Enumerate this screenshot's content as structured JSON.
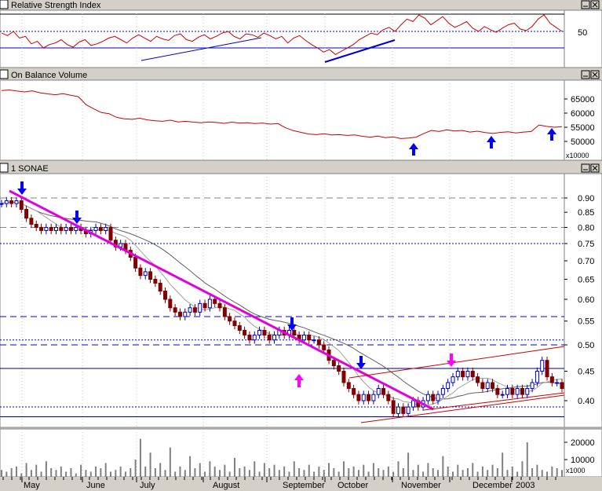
{
  "panes": {
    "rsi": {
      "title": "Relative Strength Index"
    },
    "obv": {
      "title": "On Balance Volume",
      "units": "x10000"
    },
    "price": {
      "title": "1 SONAE"
    },
    "volume": {
      "units": "x1000"
    }
  },
  "colors": {
    "price_line": "#cc0000",
    "trend_magenta": "#e000e0",
    "trend_blue": "#0000cc",
    "channel_red": "#cc0000",
    "arrow_blue": "#0000ff",
    "arrow_magenta": "#ff00ff",
    "candle_down": "#800000",
    "candle_up": "#0000c0",
    "volume_bar": "#808080",
    "ma_gray": "#606060"
  },
  "chart_data": [
    {
      "type": "line",
      "name": "Relative Strength Index",
      "ylim": [
        0,
        100
      ],
      "yticks": [
        50
      ],
      "reference_lines": [
        50,
        30,
        70
      ],
      "months": [
        "May",
        "June",
        "July",
        "August",
        "September",
        "October",
        "November",
        "December",
        "2003"
      ],
      "values": [
        48,
        45,
        50,
        42,
        44,
        35,
        38,
        30,
        34,
        36,
        40,
        34,
        31,
        37,
        40,
        33,
        35,
        38,
        42,
        44,
        40,
        36,
        42,
        46,
        42,
        38,
        44,
        41,
        39,
        45,
        47,
        40,
        38,
        43,
        46,
        41,
        44,
        48,
        50,
        44,
        41,
        47,
        46,
        43,
        48,
        45,
        41,
        44,
        36,
        42,
        45,
        39,
        34,
        30,
        25,
        28,
        22,
        26,
        30,
        34,
        40,
        44,
        48,
        46,
        52,
        55,
        50,
        58,
        65,
        62,
        70,
        66,
        58,
        63,
        68,
        60,
        55,
        58,
        62,
        54,
        50,
        56,
        52,
        49,
        54,
        58,
        60,
        53,
        51,
        56,
        65,
        70,
        60,
        55,
        50
      ]
    },
    {
      "type": "line",
      "name": "On Balance Volume",
      "ylim": [
        45000,
        70000
      ],
      "yticks": [
        50000,
        55000,
        60000,
        65000
      ],
      "units": "x10000",
      "values": [
        68000,
        68200,
        67800,
        67500,
        67900,
        67200,
        66800,
        66500,
        66900,
        66300,
        65800,
        63000,
        61500,
        60200,
        59800,
        58500,
        58000,
        57800,
        58200,
        57600,
        57300,
        57100,
        57500,
        56900,
        57100,
        56800,
        56600,
        56900,
        56700,
        56400,
        56800,
        56500,
        56600,
        56300,
        56500,
        56100,
        56300,
        54800,
        53800,
        53200,
        52600,
        52400,
        52700,
        52300,
        52400,
        52100,
        52300,
        51800,
        51500,
        51900,
        51300,
        51600,
        51000,
        51200,
        51500,
        52800,
        53900,
        53500,
        54100,
        53700,
        53900,
        53300,
        53600,
        53100,
        52800,
        53200,
        53400,
        53000,
        53300,
        53500,
        55800,
        55300,
        55000,
        55200
      ]
    },
    {
      "type": "candlestick",
      "name": "SONAE",
      "ylim": [
        0.36,
        0.96
      ],
      "yscale": "log",
      "yticks": [
        0.4,
        0.45,
        0.5,
        0.55,
        0.6,
        0.65,
        0.7,
        0.75,
        0.8,
        0.85,
        0.9
      ],
      "ytick_labels": [
        "0.40",
        "0.45",
        "0.50",
        "0.55",
        "0.60",
        "0.65",
        "0.70",
        "0.75",
        "0.80",
        "0.85",
        "0.90"
      ],
      "xlabels": [
        "May",
        "June",
        "July",
        "August",
        "September",
        "October",
        "November",
        "December",
        "2003"
      ],
      "close": [
        0.88,
        0.89,
        0.88,
        0.89,
        0.86,
        0.83,
        0.81,
        0.8,
        0.79,
        0.8,
        0.79,
        0.8,
        0.79,
        0.8,
        0.79,
        0.8,
        0.79,
        0.78,
        0.79,
        0.8,
        0.79,
        0.8,
        0.76,
        0.74,
        0.75,
        0.73,
        0.71,
        0.68,
        0.66,
        0.67,
        0.65,
        0.64,
        0.62,
        0.6,
        0.58,
        0.57,
        0.56,
        0.57,
        0.58,
        0.57,
        0.59,
        0.58,
        0.6,
        0.59,
        0.58,
        0.56,
        0.55,
        0.54,
        0.53,
        0.52,
        0.51,
        0.52,
        0.53,
        0.52,
        0.51,
        0.52,
        0.53,
        0.52,
        0.53,
        0.52,
        0.51,
        0.52,
        0.51,
        0.51,
        0.5,
        0.49,
        0.47,
        0.46,
        0.45,
        0.43,
        0.42,
        0.41,
        0.4,
        0.41,
        0.4,
        0.41,
        0.42,
        0.41,
        0.4,
        0.38,
        0.39,
        0.38,
        0.39,
        0.4,
        0.39,
        0.4,
        0.41,
        0.4,
        0.41,
        0.42,
        0.43,
        0.44,
        0.45,
        0.44,
        0.45,
        0.44,
        0.43,
        0.42,
        0.43,
        0.42,
        0.41,
        0.41,
        0.42,
        0.41,
        0.42,
        0.41,
        0.42,
        0.43,
        0.45,
        0.47,
        0.44,
        0.43,
        0.43,
        0.42
      ],
      "horizontal_lines": {
        "long_dash": [
          0.9,
          0.8,
          0.56,
          0.5
        ],
        "short_dot": [
          0.75,
          0.51,
          0.39
        ],
        "solid": [
          0.455,
          0.375
        ]
      },
      "moving_averages": [
        "short",
        "long"
      ]
    },
    {
      "type": "bar",
      "name": "Volume",
      "ylim": [
        0,
        28000
      ],
      "yticks": [
        10000,
        20000
      ],
      "units": "x1000",
      "values": [
        4000,
        3000,
        5000,
        6000,
        2000,
        8000,
        4000,
        7000,
        3000,
        9000,
        5000,
        4000,
        6000,
        3000,
        5000,
        2000,
        7000,
        4000,
        3000,
        6000,
        5000,
        8000,
        3000,
        4000,
        6000,
        3000,
        5000,
        10000,
        22000,
        6000,
        14000,
        5000,
        8000,
        4000,
        17000,
        3000,
        6000,
        4000,
        12000,
        5000,
        8000,
        3000,
        9000,
        6000,
        4000,
        7000,
        3000,
        11000,
        5000,
        6000,
        4000,
        9000,
        3000,
        8000,
        5000,
        7000,
        4000,
        6000,
        3000,
        9000,
        5000,
        4000,
        7000,
        3000,
        6000,
        4000,
        8000,
        5000,
        3000,
        9000,
        5000,
        6000,
        4000,
        7000,
        3000,
        8000,
        5000,
        4000,
        6000,
        3000,
        9000,
        5000,
        14000,
        4000,
        7000,
        3000,
        8000,
        5000,
        4000,
        12000,
        6000,
        3000,
        7000,
        4000,
        5000,
        8000,
        3000,
        6000,
        4000,
        7000,
        5000,
        14000,
        4000,
        6000,
        3000,
        9000,
        20000,
        5000,
        7000,
        4000,
        3000,
        6000,
        5000,
        4000
      ]
    }
  ]
}
